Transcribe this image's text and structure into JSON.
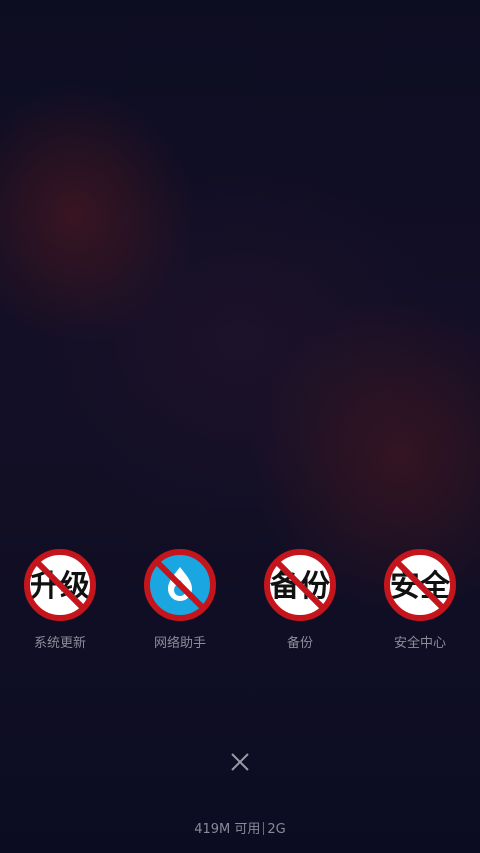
{
  "shortcuts": [
    {
      "icon_text": "升级",
      "label": "系统更新",
      "icon": "upgrade-icon"
    },
    {
      "icon_text": "",
      "label": "网络助手",
      "icon": "water-drop-icon"
    },
    {
      "icon_text": "备份",
      "label": "备份",
      "icon": "backup-icon"
    },
    {
      "icon_text": "安全",
      "label": "安全中心",
      "icon": "security-icon"
    }
  ],
  "memory": {
    "available": "419M 可用",
    "total": "2G"
  },
  "close": {
    "icon": "close-icon"
  },
  "colors": {
    "background": "#0b0c22",
    "prohibit_red": "#c4151c",
    "network_blue": "#1aa6e0",
    "label_gray": "#8c8c99"
  }
}
